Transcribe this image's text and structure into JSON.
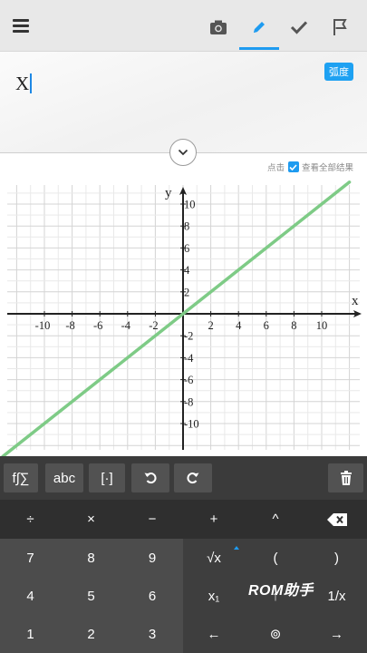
{
  "toolbar": {
    "icons": [
      "menu-icon",
      "camera-icon",
      "pencil-icon",
      "check-icon",
      "flag-icon"
    ],
    "accent": "#1e9bf0"
  },
  "input": {
    "expression": "X",
    "angle_mode": "弧度"
  },
  "options": {
    "click_label": "点击",
    "show_all_label": "查看全部结果"
  },
  "chart_data": {
    "type": "line",
    "xlabel": "x",
    "ylabel": "y",
    "xlim": [
      -13,
      13
    ],
    "ylim": [
      -13,
      11
    ],
    "x_ticks": [
      -10,
      -8,
      -6,
      -4,
      -2,
      2,
      4,
      6,
      8,
      10
    ],
    "y_ticks": [
      10,
      8,
      6,
      4,
      2,
      -2,
      -4,
      -6,
      -8,
      -10
    ],
    "grid": true,
    "series": [
      {
        "color": "#7ecb86",
        "x": [
          -13,
          12
        ],
        "y": [
          -13,
          12
        ]
      }
    ]
  },
  "keyboard": {
    "top_row": [
      "f∫∑",
      "abc",
      "[·]"
    ],
    "rows": [
      [
        "÷",
        "×",
        "−",
        "+",
        "^",
        ""
      ],
      [
        "7",
        "8",
        "9",
        "√x",
        "(",
        ")"
      ],
      [
        "4",
        "5",
        "6",
        "x₁",
        "↑",
        "1/x"
      ],
      [
        "1",
        "2",
        "3",
        "←",
        "⊚",
        "→"
      ]
    ]
  },
  "watermark": "ROM助手"
}
